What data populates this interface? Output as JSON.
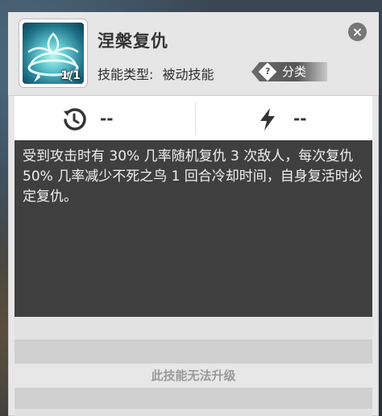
{
  "skill": {
    "name": "涅槃复仇",
    "count": "1/1",
    "type_label": "技能类型:",
    "type_value": "被动技能",
    "category_label": "分类",
    "category_help": "?"
  },
  "close_label": "×",
  "stats": {
    "cooldown_value": "--",
    "energy_value": "--"
  },
  "description": "受到攻击时有 30% 几率随机复仇 3 次敌人，每次复仇 50% 几率减少不死之鸟 1 回合冷却时间，自身复活时必定复仇。",
  "upgrade_status": "此技能无法升级",
  "icons": {
    "skill": "phoenix-icon",
    "cooldown": "cooldown-clock-icon",
    "energy": "lightning-bolt-icon",
    "close": "close-icon",
    "help": "question-icon"
  },
  "colors": {
    "panel": "#e7e7e7",
    "description_bg": "#3f3f3f",
    "close_button": "#777777",
    "category_tag": "#5a5a5a"
  }
}
